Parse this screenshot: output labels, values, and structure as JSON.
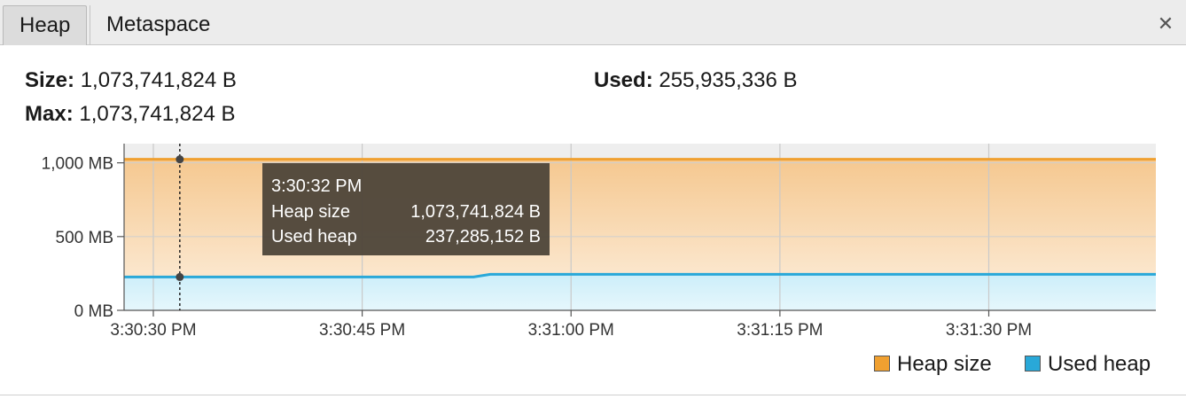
{
  "tabs": [
    {
      "label": "Heap",
      "active": true
    },
    {
      "label": "Metaspace",
      "active": false
    }
  ],
  "close_icon": "close-icon",
  "stats": {
    "size_label": "Size:",
    "size_value": "1,073,741,824 B",
    "max_label": "Max:",
    "max_value": "1,073,741,824 B",
    "used_label": "Used:",
    "used_value": "255,935,336 B"
  },
  "chart_data": {
    "type": "area",
    "y_ticks": [
      {
        "value": 0,
        "label": "0 MB"
      },
      {
        "value": 500,
        "label": "500 MB"
      },
      {
        "value": 1000,
        "label": "1,000 MB"
      }
    ],
    "ylim": [
      0,
      1130
    ],
    "x_ticks": [
      {
        "value": 30,
        "label": "3:30:30 PM"
      },
      {
        "value": 45,
        "label": "3:30:45 PM"
      },
      {
        "value": 60,
        "label": "3:31:00 PM"
      },
      {
        "value": 75,
        "label": "3:31:15 PM"
      },
      {
        "value": 90,
        "label": "3:31:30 PM"
      }
    ],
    "xlim": [
      27.9,
      102.0
    ],
    "grid": true,
    "legend_position": "bottom-right",
    "series": [
      {
        "name": "Heap size",
        "color": "#f0a030",
        "fill_top": "#f5c890",
        "fill_bottom": "#fdf0e0",
        "x": [
          27.9,
          102.0
        ],
        "y": [
          1024,
          1024
        ]
      },
      {
        "name": "Used heap",
        "color": "#29a8d8",
        "fill_top": "#cceef9",
        "fill_bottom": "#e6f7fc",
        "x": [
          27.9,
          53.0,
          54.2,
          102.0
        ],
        "y": [
          226,
          226,
          244,
          244
        ]
      }
    ],
    "crosshair": {
      "x": 31.9,
      "heap_size": 1024,
      "used_heap": 226
    },
    "tooltip": {
      "time": "3:30:32 PM",
      "rows": [
        {
          "label": "Heap size",
          "value": "1,073,741,824 B"
        },
        {
          "label": "Used heap",
          "value": "237,285,152 B"
        }
      ]
    }
  }
}
